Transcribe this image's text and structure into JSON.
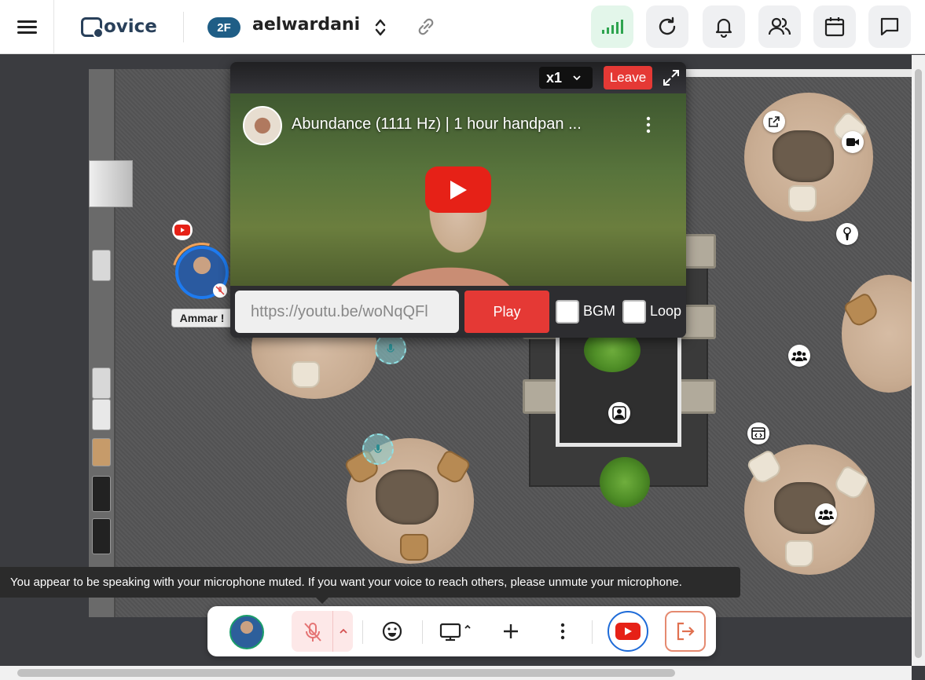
{
  "header": {
    "logo_text": "ovice",
    "floor_badge": "2F",
    "space_name": "aelwardani",
    "icons": [
      "menu-icon",
      "swap-icon",
      "link-icon",
      "signal-icon",
      "refresh-icon",
      "bell-icon",
      "users-icon",
      "calendar-icon",
      "chat-icon"
    ]
  },
  "map": {
    "user_name_tag": "Ammar !"
  },
  "youtube": {
    "speed": "x1",
    "leave_label": "Leave",
    "video_title": "Abundance (1111 Hz) | 1 hour handpan ...",
    "url_value": "https://youtu.be/woNqQFl",
    "play_label": "Play",
    "bgm_label": "BGM",
    "loop_label": "Loop",
    "bgm_checked": false,
    "loop_checked": false
  },
  "tooltip": {
    "text": "You appear to be speaking with your microphone muted. If you want your voice to reach others, please unmute your microphone."
  },
  "dock": {
    "icons": [
      "avatar",
      "mic-muted-icon",
      "emoji-icon",
      "screen-share-icon",
      "plus-icon",
      "more-icon",
      "youtube-icon",
      "exit-icon"
    ]
  },
  "colors": {
    "brand": "#29405a",
    "accent_red": "#e53935",
    "floor_badge_bg": "#1f5e86",
    "signal_green": "#2ea44f"
  }
}
